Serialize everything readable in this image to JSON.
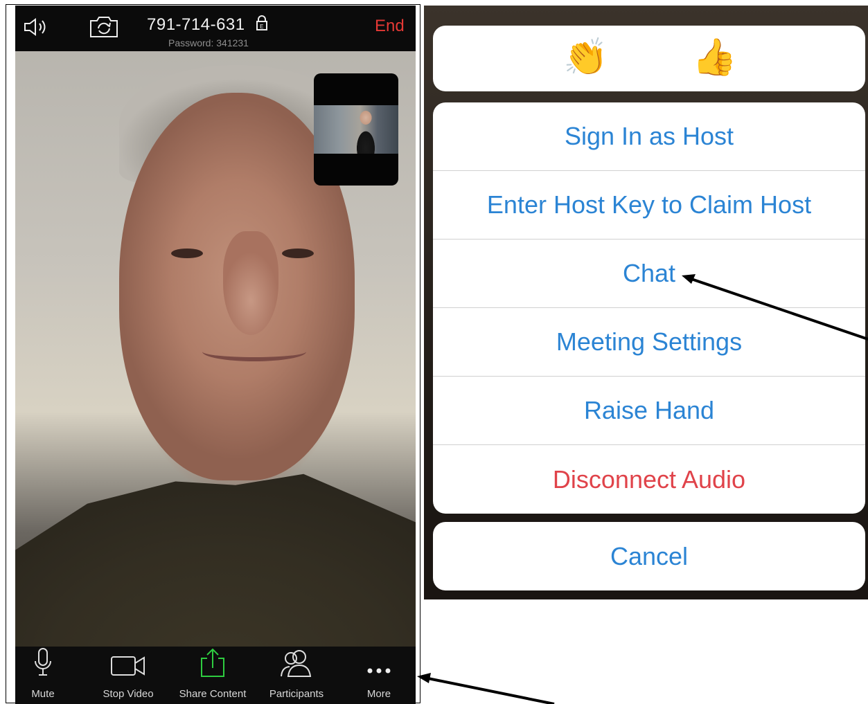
{
  "call": {
    "meeting_id": "791-714-631",
    "password_text": "Password: 341231",
    "end_label": "End"
  },
  "toolbar": {
    "items": [
      {
        "label": "Mute",
        "icon": "microphone-icon"
      },
      {
        "label": "Stop Video",
        "icon": "video-camera-icon"
      },
      {
        "label": "Share Content",
        "icon": "share-upload-icon"
      },
      {
        "label": "Participants",
        "icon": "participants-icon"
      },
      {
        "label": "More",
        "icon": "more-dots-icon"
      }
    ]
  },
  "reactions": {
    "clap": "👏",
    "thumbs_up": "👍"
  },
  "menu": {
    "items": [
      {
        "label": "Sign In as Host"
      },
      {
        "label": "Enter Host Key to Claim Host"
      },
      {
        "label": "Chat"
      },
      {
        "label": "Meeting Settings"
      },
      {
        "label": "Raise Hand"
      },
      {
        "label": "Disconnect Audio"
      }
    ],
    "cancel_label": "Cancel"
  },
  "colors": {
    "accent_blue": "#2b84d4",
    "danger_red": "#e0434a",
    "end_red": "#e53935",
    "share_green": "#2ecc40"
  }
}
